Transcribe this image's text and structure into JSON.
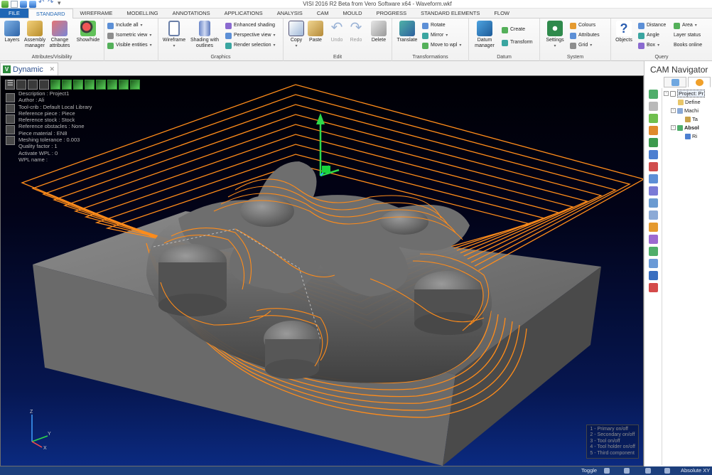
{
  "window": {
    "title": "VISI 2016 R2 Beta from Vero Software x64 - Waveform.wkf"
  },
  "ribbon_tabs": [
    {
      "label": "FILE"
    },
    {
      "label": "STANDARD"
    },
    {
      "label": "WIREFRAME"
    },
    {
      "label": "MODELLING"
    },
    {
      "label": "ANNOTATIONS"
    },
    {
      "label": "APPLICATIONS"
    },
    {
      "label": "ANALYSIS"
    },
    {
      "label": "CAM"
    },
    {
      "label": "MOULD"
    },
    {
      "label": "PROGRESS"
    },
    {
      "label": "STANDARD ELEMENTS"
    },
    {
      "label": "FLOW"
    }
  ],
  "active_tab": "STANDARD",
  "groups": {
    "attributes": {
      "label": "Attributes/Visibility",
      "layers": "Layers",
      "assembly": "Assembly manager",
      "change": "Change attributes",
      "show_hide": "Show/hide",
      "include_all": "Include all",
      "isometric_view": "Isometric view",
      "visible_entities": "Visible entities"
    },
    "graphics": {
      "label": "Graphics",
      "wireframe": "Wireframe",
      "shading": "Shading with outlines",
      "enhanced_shading": "Enhanced shading",
      "perspective_view": "Perspective view",
      "render_selection": "Render selection"
    },
    "edit": {
      "label": "Edit",
      "copy": "Copy",
      "paste": "Paste",
      "undo": "Undo",
      "redo": "Redo",
      "delete": "Delete"
    },
    "transformations": {
      "label": "Transformations",
      "translate": "Translate",
      "rotate": "Rotate",
      "mirror": "Mirror",
      "move_to_wpl": "Move to wpl"
    },
    "datum": {
      "label": "Datum",
      "datum_manager": "Datum manager",
      "create": "Create",
      "transform": "Transform"
    },
    "system": {
      "label": "System",
      "settings": "Settings",
      "colours": "Colours",
      "attributes": "Attributes",
      "grid": "Grid"
    },
    "query": {
      "label": "Query",
      "objects": "Objects",
      "distance": "Distance",
      "angle": "Angle",
      "box": "Box",
      "area": "Area",
      "layer_status": "Layer status",
      "books_online": "Books online"
    }
  },
  "viewport": {
    "tab_label": "Dynamic",
    "tab_logo": "V",
    "info_lines": [
      "Description : Project1",
      "Author : Ali",
      "Tool-crib : Default Local Library",
      "Reference piece : Piece",
      "Reference stock : Stock",
      "Reference obstacles : None",
      "Piece material : EN8",
      "Meshing tolerance : 0.003",
      "Quality factor : 1",
      "Activate WPL : 0",
      "WPL name :"
    ],
    "legend_lines": [
      "1 - Primary on/off",
      "2 - Secondary on/off",
      "3 - Tool on/off",
      "4 - Tool holder on/off",
      "5 - Third component"
    ],
    "axis_labels": {
      "z": "Z",
      "y": "Y",
      "x": "X"
    },
    "colors": {
      "toolpath": "#ff8c1a",
      "part": "#5a5a5a",
      "block": "#6b6b6b",
      "background_top": "#000004",
      "background_bottom": "#0b2a80"
    }
  },
  "cam_navigator": {
    "title": "CAM Navigator",
    "tree": [
      {
        "label": "Project: Pr",
        "level": 0,
        "selected": true,
        "bold": false,
        "expander": "-"
      },
      {
        "label": "Define",
        "level": 1,
        "selected": false,
        "bold": false,
        "expander": ""
      },
      {
        "label": "Machi",
        "level": 1,
        "selected": false,
        "bold": false,
        "expander": "-"
      },
      {
        "label": "Ta",
        "level": 2,
        "selected": false,
        "bold": false,
        "expander": ""
      },
      {
        "label": "Absol",
        "level": 1,
        "selected": false,
        "bold": true,
        "expander": "-"
      },
      {
        "label": "Ri",
        "level": 2,
        "selected": false,
        "bold": false,
        "expander": ""
      }
    ]
  },
  "statusbar": {
    "toggle": "Toggle",
    "coords_mode": "Absolute XY"
  }
}
